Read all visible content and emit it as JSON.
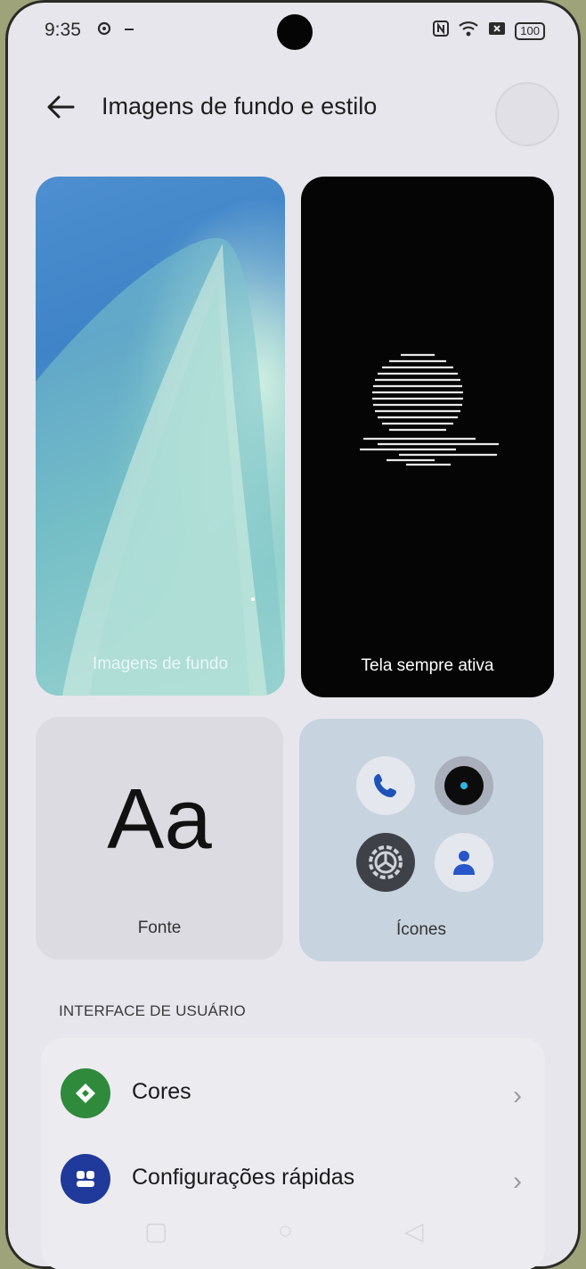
{
  "status_bar": {
    "time": "9:35",
    "battery": "100",
    "icons": [
      "settings-icon",
      "minus-icon",
      "nfc-icon",
      "wifi-icon",
      "sim-icon",
      "battery-icon"
    ]
  },
  "header": {
    "title": "Imagens de fundo e estilo",
    "back_icon": "arrow-left-icon",
    "avatar_icon": "avatar-circle"
  },
  "cards": {
    "wallpaper": {
      "label": "Imagens de fundo"
    },
    "always_on": {
      "label": "Tela sempre ativa"
    },
    "font": {
      "label": "Fonte",
      "preview": "Aa"
    },
    "icons": {
      "label": "Ícones",
      "apps": [
        "phone-icon",
        "camera-icon",
        "settings-icon",
        "contacts-icon"
      ]
    }
  },
  "section": {
    "title": "INTERFACE DE USUÁRIO",
    "items": [
      {
        "label": "Cores",
        "icon": "palette-icon",
        "color": "#2f8a3b"
      },
      {
        "label": "Configurações rápidas",
        "icon": "quick-settings-icon",
        "color": "#1f3a9a"
      }
    ]
  },
  "colors": {
    "background": "#e7e6ec",
    "aod_background": "#050505"
  }
}
